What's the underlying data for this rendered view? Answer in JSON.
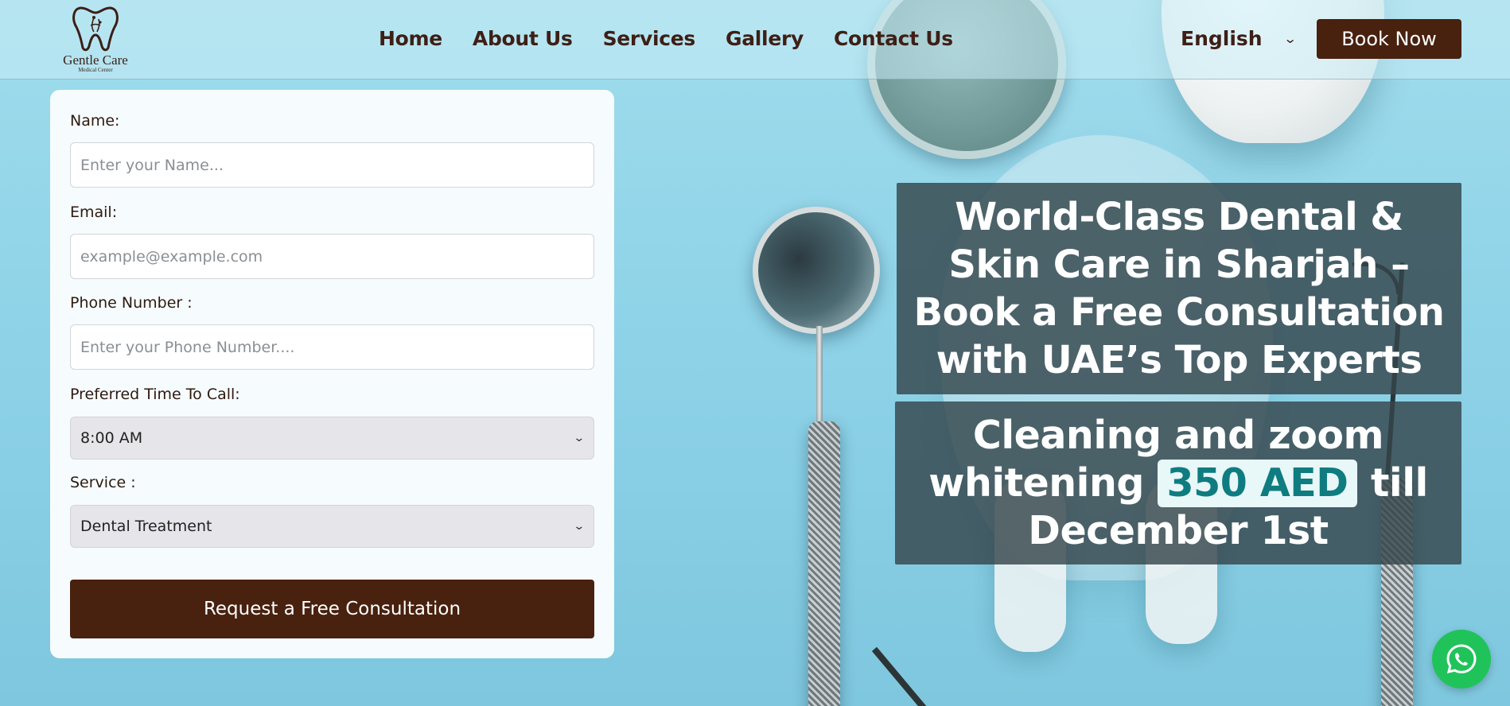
{
  "brand": {
    "name": "Gentle Care",
    "subtitle": "Medical Center"
  },
  "nav": {
    "items": [
      {
        "label": "Home"
      },
      {
        "label": "About Us"
      },
      {
        "label": "Services"
      },
      {
        "label": "Gallery"
      },
      {
        "label": "Contact Us"
      }
    ]
  },
  "language": {
    "selected": "English"
  },
  "header": {
    "book_label": "Book Now"
  },
  "form": {
    "name": {
      "label": "Name:",
      "placeholder": "Enter your Name..."
    },
    "email": {
      "label": "Email:",
      "placeholder": "example@example.com"
    },
    "phone": {
      "label": "Phone Number :",
      "placeholder": "Enter your Phone Number...."
    },
    "time": {
      "label": "Preferred Time To Call:",
      "selected": "8:00 AM"
    },
    "service": {
      "label": "Service :",
      "selected": "Dental Treatment"
    },
    "submit_label": "Request a Free Consultation"
  },
  "promo": {
    "headline": "World-Class Dental & Skin Care in Sharjah – Book a Free Consultation with UAE’s Top Experts",
    "offer_part1": "Cleaning and zoom whitening",
    "offer_price": "350 AED",
    "offer_part2": "till December 1st"
  },
  "colors": {
    "primary": "#48210f",
    "nav_text": "#3e1f16",
    "price_text": "#0f7c80",
    "whatsapp": "#20c35a",
    "background": "#8fd3e8"
  },
  "icons": {
    "whatsapp": "whatsapp-icon",
    "chevron": "chevron-down-icon",
    "logo": "tooth-logo-icon"
  }
}
